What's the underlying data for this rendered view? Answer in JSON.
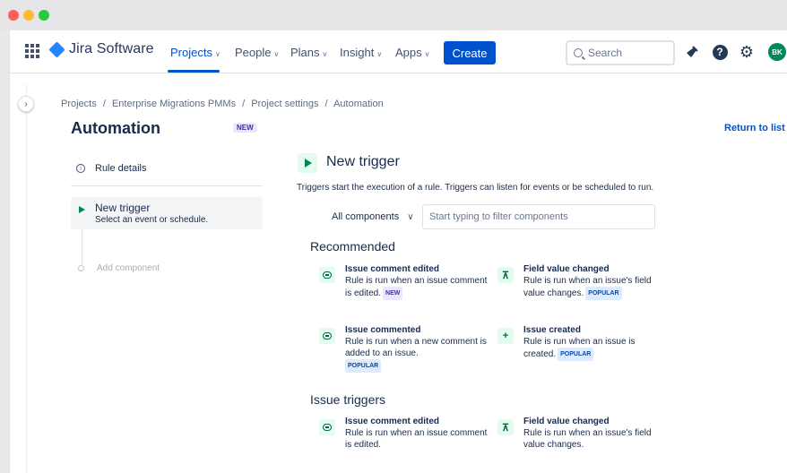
{
  "nav": {
    "app_name": "Jira Software",
    "items": [
      {
        "label": "Projects",
        "active": true
      },
      {
        "label": "People",
        "active": false
      },
      {
        "label": "Plans",
        "active": false
      },
      {
        "label": "Insight",
        "active": false
      },
      {
        "label": "Apps",
        "active": false
      }
    ],
    "create_label": "Create",
    "search_placeholder": "Search",
    "avatar_initials": "BK"
  },
  "breadcrumb": [
    "Projects",
    "Enterprise Migrations PMMs",
    "Project settings",
    "Automation"
  ],
  "breadcrumb_sep": "/",
  "page": {
    "title": "Automation",
    "title_badge": "NEW",
    "return_link": "Return to list"
  },
  "rule_panel": {
    "rule_details_label": "Rule details",
    "trigger_title": "New trigger",
    "trigger_subtitle": "Select an event or schedule.",
    "add_component_label": "Add component"
  },
  "main": {
    "heading": "New trigger",
    "description": "Triggers start the execution of a rule. Triggers can listen for events or be scheduled to run.",
    "filter_select_value": "All components",
    "filter_placeholder": "Start typing to filter components",
    "recommended_title": "Recommended",
    "issue_triggers_title": "Issue triggers",
    "recommended": [
      {
        "icon": "comment-icon",
        "name": "Issue comment edited",
        "desc": "Rule is run when an issue comment is edited.",
        "badge": "NEW"
      },
      {
        "icon": "field-value-icon",
        "name": "Field value changed",
        "desc": "Rule is run when an issue's field value changes.",
        "badge": "POPULAR"
      },
      {
        "icon": "comment-icon",
        "name": "Issue commented",
        "desc": "Rule is run when a new comment is added to an issue.",
        "badge": "POPULAR"
      },
      {
        "icon": "plus-icon",
        "name": "Issue created",
        "desc": "Rule is run when an issue is created.",
        "badge": "POPULAR"
      }
    ],
    "issue_triggers": [
      {
        "icon": "comment-icon",
        "name": "Issue comment edited",
        "desc": "Rule is run when an issue comment is edited."
      },
      {
        "icon": "field-value-icon",
        "name": "Field value changed",
        "desc": "Rule is run when an issue's field value changes."
      }
    ]
  },
  "colors": {
    "brand_blue": "#0052cc",
    "trigger_green": "#00875a",
    "new_lozenge_bg": "#eae6ff",
    "popular_lozenge_bg": "#deebff"
  }
}
